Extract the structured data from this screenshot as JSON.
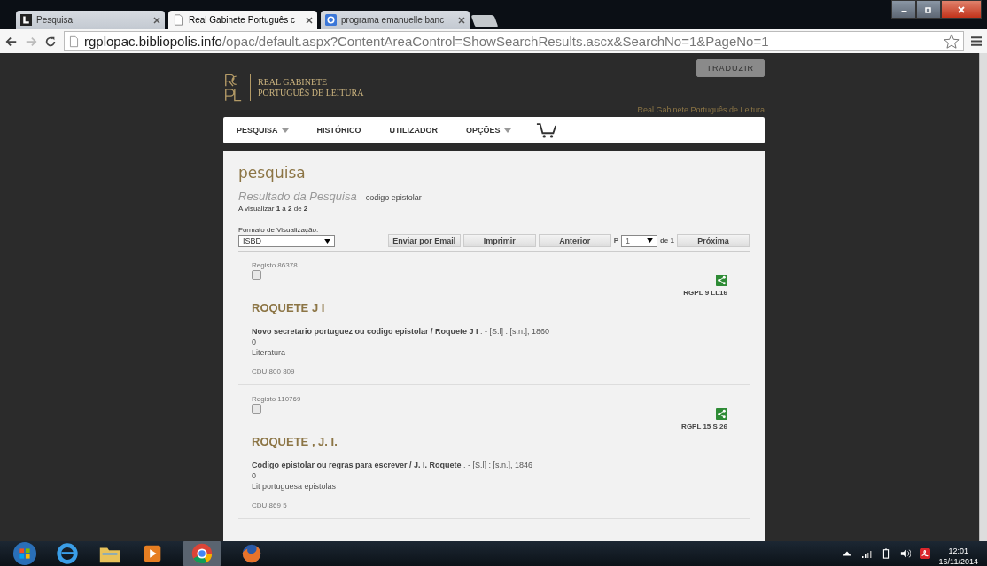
{
  "browser": {
    "tabs": [
      {
        "title": "Pesquisa",
        "selected": false
      },
      {
        "title": "Real Gabinete Português c",
        "selected": true
      },
      {
        "title": "programa emanuelle banc",
        "selected": false
      }
    ],
    "url": {
      "host": "rgplopac.bibliopolis.info",
      "path": "/opac/default.aspx?ContentAreaControl=ShowSearchResults.ascx&SearchNo=1&PageNo=1"
    }
  },
  "header": {
    "logo_lines": [
      "REAL GABINETE",
      "PORTUGUÊS DE LEITURA"
    ],
    "translate_button": "TRADUZIR",
    "subtitle": "Real Gabinete Português de Leitura"
  },
  "nav": [
    {
      "label": "PESQUISA",
      "dropdown": true
    },
    {
      "label": "HISTÓRICO",
      "dropdown": false
    },
    {
      "label": "UTILIZADOR",
      "dropdown": false
    },
    {
      "label": "OPÇÕES",
      "dropdown": true
    }
  ],
  "page": {
    "title": "pesquisa",
    "result_heading": "Resultado da Pesquisa",
    "query": "codigo epistolar",
    "showing": "A visualizar **1** a **2** de **2**",
    "format_label": "Formato de Visualização:",
    "format_value": "ISBD",
    "buttons": [
      "Enviar por Email",
      "Imprimir",
      "Anterior"
    ],
    "page_label": "P",
    "page_value": "1",
    "page_total": "de 1",
    "next_button": "Próxima"
  },
  "records": [
    {
      "registo": "Registo 86378",
      "checked": false,
      "call_number": "RGPL 9 LL16",
      "author": "ROQUETE J I",
      "description": "**Novo secretario portuguez ou codigo epistolar / Roquete J I** . - [S.l] : [s.n.], 1860",
      "line_2": "0",
      "subject": "Literatura",
      "cdu": "CDU 800 809"
    },
    {
      "registo": "Registo 110769",
      "checked": false,
      "call_number": "RGPL 15 S 26",
      "author": "ROQUETE , J. I.",
      "description": "**Codigo epistolar ou regras para escrever / J. I. Roquete** . - [S.l] : [s.n.], 1846",
      "line_2": "0",
      "subject": "Lit portuguesa epistolas",
      "cdu": "CDU 869 5"
    }
  ],
  "taskbar": {
    "time": "12:01",
    "date": "16/11/2014"
  }
}
